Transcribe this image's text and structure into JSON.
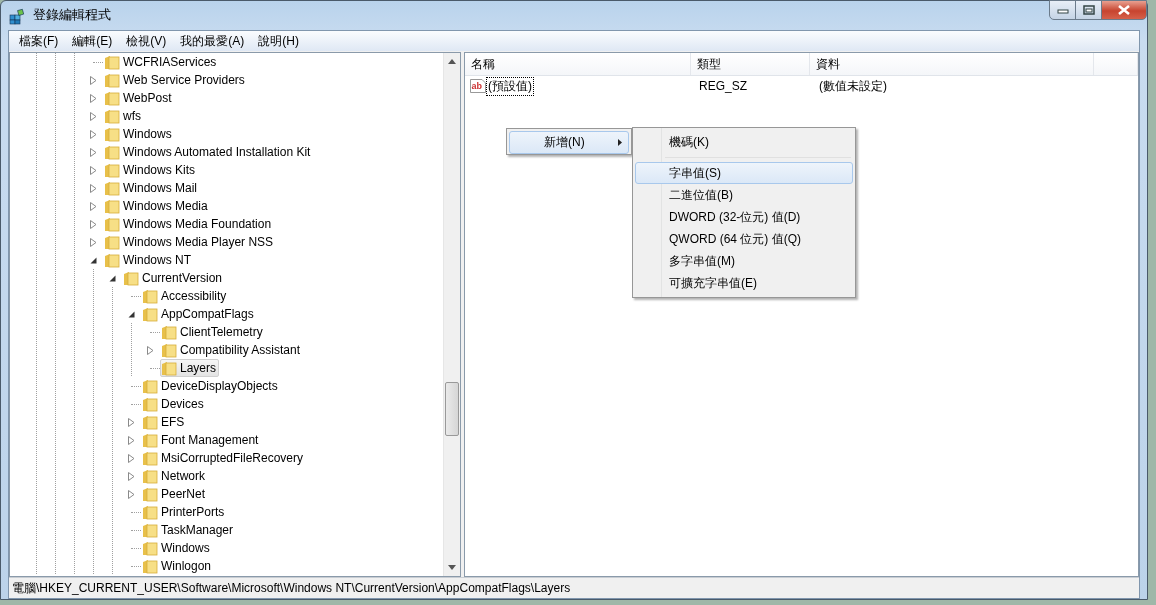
{
  "window": {
    "title": "登錄編輯程式"
  },
  "menu": [
    "檔案(F)",
    "編輯(E)",
    "檢視(V)",
    "我的最愛(A)",
    "說明(H)"
  ],
  "tree": {
    "items": [
      {
        "label": "WCFRIAServices",
        "has_children": false,
        "selected": false
      },
      {
        "label": "Web Service Providers",
        "has_children": true,
        "expanded": false,
        "selected": false
      },
      {
        "label": "WebPost",
        "has_children": true,
        "expanded": false,
        "selected": false
      },
      {
        "label": "wfs",
        "has_children": true,
        "expanded": false,
        "selected": false
      },
      {
        "label": "Windows",
        "has_children": true,
        "expanded": false,
        "selected": false
      },
      {
        "label": "Windows Automated Installation Kit",
        "has_children": true,
        "expanded": false,
        "selected": false
      },
      {
        "label": "Windows Kits",
        "has_children": true,
        "expanded": false,
        "selected": false
      },
      {
        "label": "Windows Mail",
        "has_children": true,
        "expanded": false,
        "selected": false
      },
      {
        "label": "Windows Media",
        "has_children": true,
        "expanded": false,
        "selected": false
      },
      {
        "label": "Windows Media Foundation",
        "has_children": true,
        "expanded": false,
        "selected": false
      },
      {
        "label": "Windows Media Player NSS",
        "has_children": true,
        "expanded": false,
        "selected": false
      },
      {
        "label": "Windows NT",
        "has_children": true,
        "expanded": true,
        "selected": false,
        "children": [
          {
            "label": "CurrentVersion",
            "has_children": true,
            "expanded": true,
            "selected": false,
            "children": [
              {
                "label": "Accessibility",
                "has_children": false,
                "selected": false
              },
              {
                "label": "AppCompatFlags",
                "has_children": true,
                "expanded": true,
                "selected": false,
                "children": [
                  {
                    "label": "ClientTelemetry",
                    "has_children": false,
                    "selected": false
                  },
                  {
                    "label": "Compatibility Assistant",
                    "has_children": true,
                    "expanded": false,
                    "selected": false
                  },
                  {
                    "label": "Layers",
                    "has_children": false,
                    "selected": true
                  }
                ]
              },
              {
                "label": "DeviceDisplayObjects",
                "has_children": false,
                "selected": false
              },
              {
                "label": "Devices",
                "has_children": false,
                "selected": false
              },
              {
                "label": "EFS",
                "has_children": true,
                "expanded": false,
                "selected": false
              },
              {
                "label": "Font Management",
                "has_children": true,
                "expanded": false,
                "selected": false
              },
              {
                "label": "MsiCorruptedFileRecovery",
                "has_children": true,
                "expanded": false,
                "selected": false
              },
              {
                "label": "Network",
                "has_children": true,
                "expanded": false,
                "selected": false
              },
              {
                "label": "PeerNet",
                "has_children": true,
                "expanded": false,
                "selected": false
              },
              {
                "label": "PrinterPorts",
                "has_children": false,
                "selected": false
              },
              {
                "label": "TaskManager",
                "has_children": false,
                "selected": false
              },
              {
                "label": "Windows",
                "has_children": false,
                "selected": false
              },
              {
                "label": "Winlogon",
                "has_children": false,
                "selected": false
              }
            ]
          }
        ]
      }
    ]
  },
  "list": {
    "columns": [
      "名稱",
      "類型",
      "資料"
    ],
    "rows": [
      {
        "icon_text": "ab",
        "name": "(預設值)",
        "type": "REG_SZ",
        "data": "(數值未設定)",
        "focused": true
      }
    ]
  },
  "context_menu": {
    "items": [
      {
        "label": "新增(N)",
        "selected": true
      }
    ]
  },
  "submenu": {
    "items": [
      {
        "kind": "item",
        "label": "機碼(K)",
        "selected": false
      },
      {
        "kind": "separator"
      },
      {
        "kind": "item",
        "label": "字串值(S)",
        "selected": true
      },
      {
        "kind": "item",
        "label": "二進位值(B)",
        "selected": false
      },
      {
        "kind": "item",
        "label": "DWORD (32-位元) 值(D)",
        "selected": false
      },
      {
        "kind": "item",
        "label": "QWORD (64 位元) 值(Q)",
        "selected": false
      },
      {
        "kind": "item",
        "label": "多字串值(M)",
        "selected": false
      },
      {
        "kind": "item",
        "label": "可擴充字串值(E)",
        "selected": false
      }
    ]
  },
  "status_bar": "電腦\\HKEY_CURRENT_USER\\Software\\Microsoft\\Windows NT\\CurrentVersion\\AppCompatFlags\\Layers"
}
